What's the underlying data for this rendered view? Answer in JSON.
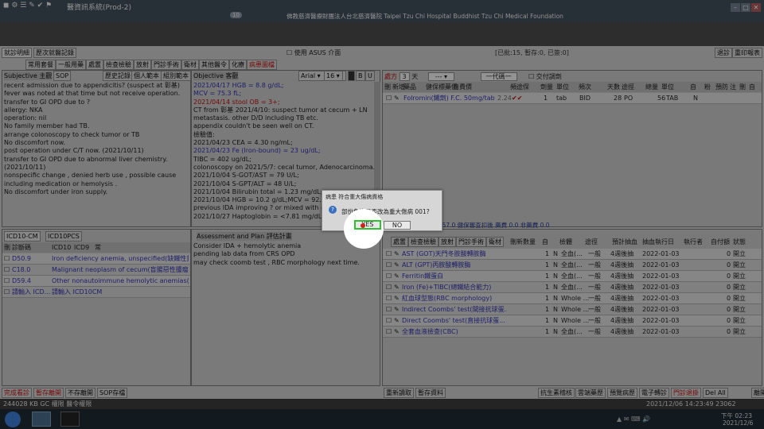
{
  "window": {
    "title": "醫資訊系統(Prod-2)",
    "hospital": "佛教慈濟醫療財團法人台北慈濟醫院 Taipei Tzu Chi Hospital Buddhist Tzu Chi Medical Foundation",
    "counter": "10"
  },
  "tabs": {
    "current": "就診明細",
    "history": "歷次就醫記錄"
  },
  "toolbar": {
    "items": [
      "常用套餐",
      "一般用藥",
      "處置",
      "檢查檢驗",
      "放射",
      "門診手術",
      "衛材",
      "其他醫令",
      "化療",
      "病患圖檔"
    ],
    "asus": "使用 ASUS 介面",
    "counts": "[已批:15, 暫存:0, 已簽:0]",
    "cancel": "退診",
    "reprint": "重印報表"
  },
  "subjective": {
    "title": "Subjective 主觀",
    "sop": "SOP",
    "history_btn": "歷史記錄",
    "template_btn": "個人範本",
    "group_btn": "組別範本",
    "lines": [
      "recent admission due to appendicitis? (suspect at 彰基)",
      "fever was noted at that time but not receive operation.",
      "transfer to GI OPD due to ?",
      "allergy: NKA",
      "operation: nil",
      "No family member had TB.",
      "arrange colonoscopy to check tumor or TB",
      "No discomfort now.",
      "post operation under C/T now. (2021/10/11)",
      "transfer to GI OPD due to abnormal liver chemistry.",
      "(2021/10/11)",
      "nonspecific change , denied herb use , possible cause",
      "including medication or hemolysis .",
      "No discomfort under iron supply."
    ]
  },
  "objective": {
    "title": "Objective 客觀",
    "font": "Arial",
    "size": "16",
    "lines": [
      {
        "t": "2021/04/17 HGB = 8.8 g/dL;",
        "c": "blue"
      },
      {
        "t": "MCV = 75.3 fL;",
        "c": "blue"
      },
      {
        "t": "2021/04/14 stool OB = 3+;",
        "c": "red"
      },
      {
        "t": "CT from 彰基 2021/4/10: suspect tumor at cecum + LN",
        "c": ""
      },
      {
        "t": "metastasis. other D/D including TB etc.",
        "c": ""
      },
      {
        "t": "appendix couldn't be seen well on CT.",
        "c": ""
      },
      {
        "t": "檢驗值:",
        "c": ""
      },
      {
        "t": "2021/04/23 CEA = 4.30 ng/mL;",
        "c": ""
      },
      {
        "t": "2021/04/23 Fe (Iron-bound) = 23 ug/dL;",
        "c": "blue"
      },
      {
        "t": "TIBC = 402 ug/dL;",
        "c": ""
      },
      {
        "t": "colonoscopy on 2021/5/7: cecal tumor, Adenocarcinoma.",
        "c": ""
      },
      {
        "t": "2021/10/04 S-GOT/AST = 79 U/L;",
        "c": ""
      },
      {
        "t": "2021/10/04 S-GPT/ALT = 48 U/L;",
        "c": ""
      },
      {
        "t": "2021/10/04 Bilirubin total = 1.23 mg/dL;",
        "c": ""
      },
      {
        "t": "2021/10/04 HGB = 10.2 g/dL;MCV = 92.5 fL;",
        "c": ""
      },
      {
        "t": "previous IDA improving ? or mixed with oth",
        "c": ""
      },
      {
        "t": "2021/10/27 Haptoglobin = <7.81 mg/dL;",
        "c": ""
      }
    ]
  },
  "rx": {
    "qty_label": "處方",
    "qty": "3",
    "days_label": "天",
    "code_label": "一代碼一",
    "self_pay": "交付調劑",
    "headers": [
      "刪",
      "新增",
      "藥品",
      "健保標藥價",
      "自費價",
      "頻",
      "途",
      "保",
      "劑量",
      "單位",
      "頻次",
      "天數",
      "途徑",
      "總量",
      "單位",
      "自",
      "粉",
      "預防",
      "注",
      "刪",
      "自"
    ],
    "row": {
      "name": "Folromin(鐵劑) F.C. 50mg/tab (...",
      "price": "2.24",
      "dose": "1",
      "unit": "tab",
      "freq": "BID",
      "days": "28",
      "route": "PO",
      "total": "56",
      "total_unit": "TAB",
      "self": "N"
    }
  },
  "fee_summary": "28389.0 非藥費 16057.0 健保審查扣後 藥費 0.0 非藥費 0.0",
  "icd": {
    "tab1": "ICD10-CM",
    "tab2": "ICD10PCS",
    "col_del": "刪",
    "col_code": "診斷碼",
    "col_icd10": "ICD10",
    "col_icd9": "ICD9",
    "col_common": "常",
    "rows": [
      {
        "code": "D50.9",
        "desc": "Iron deficiency anemia, unspecified(缺鐵性貧血)"
      },
      {
        "code": "C18.0",
        "desc": "Malignant neoplasm of cecum(盲腸惡性腫瘤)"
      },
      {
        "code": "D59.4",
        "desc": "Other nonautoimmune hemolytic anemias(其他..."
      },
      {
        "code": "請輸入 ICD...",
        "desc": "請輸入 ICD10CM"
      }
    ]
  },
  "assessment": {
    "title": "Assessment and Plan 評估計畫",
    "lines": [
      "Consider IDA + hemolytic anemia",
      "pending lab data from CRS OPD",
      "may check coomb test , RBC morphology next time."
    ]
  },
  "lab": {
    "toolbar": [
      "處置",
      "檢查檢驗",
      "放射",
      "門診手術",
      "衛材"
    ],
    "headers": [
      "刪",
      "新",
      "數量",
      "自",
      "檢體",
      "途徑",
      "預計抽血",
      "抽血執行日",
      "執行者",
      "自付額",
      "狀態"
    ],
    "rows": [
      {
        "name": "AST (GOT)天門冬胺酸轉胺酶",
        "qty": "1",
        "self": "N",
        "spec": "全血(...",
        "type": "一般",
        "draw": "4週後抽",
        "date": "2022-01-03",
        "fee": "0",
        "status": "開立"
      },
      {
        "name": "ALT (GPT)丙胺酸轉胺酶",
        "qty": "1",
        "self": "N",
        "spec": "全血(...",
        "type": "一般",
        "draw": "4週後抽",
        "date": "2022-01-03",
        "fee": "0",
        "status": "開立"
      },
      {
        "name": "Ferritin鐵蛋白",
        "qty": "1",
        "self": "N",
        "spec": "全血(...",
        "type": "一般",
        "draw": "4週後抽",
        "date": "2022-01-03",
        "fee": "0",
        "status": "開立"
      },
      {
        "name": "Iron (Fe)+TIBC(總鐵結合能力)",
        "qty": "1",
        "self": "N",
        "spec": "全血(...",
        "type": "一般",
        "draw": "4週後抽",
        "date": "2022-01-03",
        "fee": "0",
        "status": "開立"
      },
      {
        "name": "紅血球型態(RBC morphology)",
        "qty": "1",
        "self": "N",
        "spec": "Whole ...",
        "type": "一般",
        "draw": "4週後抽",
        "date": "2022-01-03",
        "fee": "0",
        "status": "開立"
      },
      {
        "name": "Indirect Coombs' test(間接抗球蛋...",
        "qty": "1",
        "self": "N",
        "spec": "Whole ...",
        "type": "一般",
        "draw": "4週後抽",
        "date": "2022-01-03",
        "fee": "0",
        "status": "開立"
      },
      {
        "name": "Direct Coombs' test(直接抗球蛋...",
        "qty": "1",
        "self": "N",
        "spec": "Whole ...",
        "type": "一般",
        "draw": "4週後抽",
        "date": "2022-01-03",
        "fee": "0",
        "status": "開立"
      },
      {
        "name": "全套血液檢查(CBC)",
        "qty": "1",
        "self": "N",
        "spec": "全血(...",
        "type": "一般",
        "draw": "4週後抽",
        "date": "2022-01-03",
        "fee": "0",
        "status": "開立"
      }
    ]
  },
  "bottom": {
    "left": [
      "完成看診",
      "暫存離開",
      "不存離開",
      "SOP存檔"
    ],
    "mid": [
      "重新讀取",
      "暫存資料"
    ],
    "right": [
      "抗生素稽核",
      "雲端藥歷",
      "預覽病歷",
      "電子轉診",
      "門診退掛",
      "Del All",
      "離開病歷"
    ]
  },
  "status": {
    "left": "244028 KB  GC  權限 醫令權限",
    "right": "2021/12/06 14:23:49  23062  10.3.36.72"
  },
  "dialog": {
    "title": "病患 符合重大傷病資格",
    "message": "部份負擔是否改為重大傷病 001?",
    "yes": "YES",
    "no": "NO"
  },
  "clock": {
    "time": "下午 02:23",
    "date": "2021/12/6"
  }
}
